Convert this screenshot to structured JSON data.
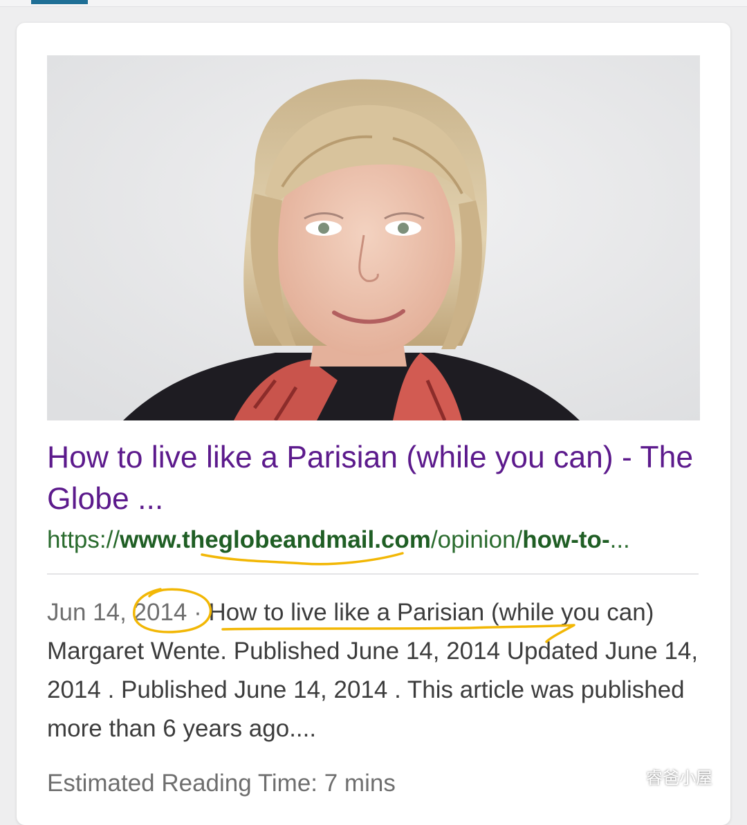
{
  "result": {
    "title": "How to live like a Parisian (while you can) - The Globe ...",
    "url": {
      "scheme": "https://",
      "domain": "www.theglobeandmail.com",
      "path": "/opinion/",
      "slug": "how-to-",
      "ellipsis": "..."
    },
    "snippet": {
      "date": "Jun 14, 2014 · ",
      "text": "How to live like a Parisian (while you can) Margaret Wente. Published June 14, 2014 Updated June 14, 2014 . Published June 14, 2014 . This article was published more than 6 years ago...."
    },
    "reading_time": "Estimated Reading Time: 7 mins"
  },
  "watermark": {
    "text": "睿爸小屋",
    "icon": "wechat-icon"
  },
  "colors": {
    "title_visited": "#5c1a8c",
    "url_green": "#2a6b2e",
    "annotation_marker": "#f2b705",
    "top_tab_accent": "#1f6f96"
  }
}
